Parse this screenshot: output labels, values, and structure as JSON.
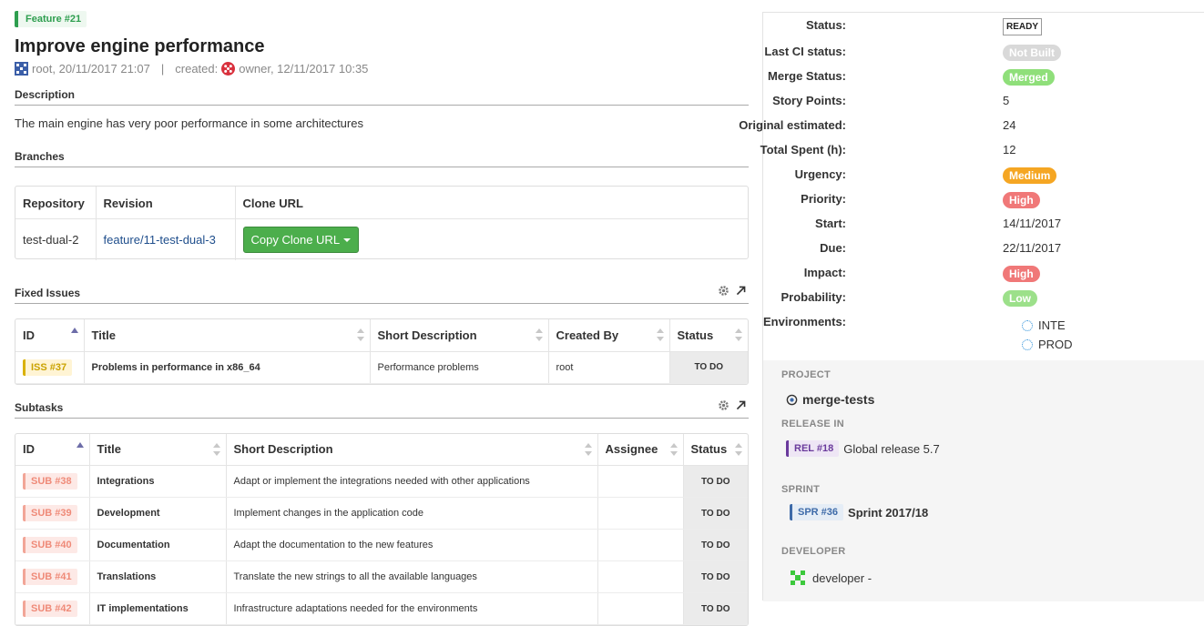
{
  "feature": {
    "badge": "Feature #21",
    "title": "Improve engine performance",
    "modified_by": "root, 20/11/2017 21:07",
    "separator": "|",
    "created_label": "created:",
    "created_by": "owner, 12/11/2017 10:35"
  },
  "description": {
    "heading": "Description",
    "text": "The main engine has very poor performance in some architectures"
  },
  "branches": {
    "heading": "Branches",
    "columns": [
      "Repository",
      "Revision",
      "Clone URL"
    ],
    "row": {
      "repository": "test-dual-2",
      "revision": "feature/11-test-dual-3",
      "clone_button": "Copy Clone URL"
    }
  },
  "fixed_issues": {
    "heading": "Fixed Issues",
    "columns": [
      "ID",
      "Title",
      "Short Description",
      "Created By",
      "Status"
    ],
    "rows": [
      {
        "id": "ISS #37",
        "title": "Problems in performance in x86_64",
        "short": "Performance problems",
        "created_by": "root",
        "status": "TO DO"
      }
    ]
  },
  "subtasks": {
    "heading": "Subtasks",
    "columns": [
      "ID",
      "Title",
      "Short Description",
      "Assignee",
      "Status"
    ],
    "rows": [
      {
        "id": "SUB #38",
        "title": "Integrations",
        "short": "Adapt or implement the integrations needed with other applications",
        "assignee": "",
        "status": "TO DO"
      },
      {
        "id": "SUB #39",
        "title": "Development",
        "short": "Implement changes in the application code",
        "assignee": "",
        "status": "TO DO"
      },
      {
        "id": "SUB #40",
        "title": "Documentation",
        "short": "Adapt the documentation to the new features",
        "assignee": "",
        "status": "TO DO"
      },
      {
        "id": "SUB #41",
        "title": "Translations",
        "short": "Translate the new strings to all the available languages",
        "assignee": "",
        "status": "TO DO"
      },
      {
        "id": "SUB #42",
        "title": "IT implementations",
        "short": "Infrastructure adaptations needed for the environments",
        "assignee": "",
        "status": "TO DO"
      }
    ]
  },
  "properties": {
    "status": {
      "label": "Status:",
      "value": "READY"
    },
    "last_ci": {
      "label": "Last CI status:",
      "value": "Not Built",
      "color": "#d9d9d9"
    },
    "merge": {
      "label": "Merge Status:",
      "value": "Merged",
      "color": "#8fdf7a"
    },
    "story_points": {
      "label": "Story Points:",
      "value": "5"
    },
    "original_estimated": {
      "label": "Original estimated:",
      "value": "24"
    },
    "total_spent": {
      "label": "Total Spent (h):",
      "value": "12"
    },
    "urgency": {
      "label": "Urgency:",
      "value": "Medium",
      "color": "#f5a623"
    },
    "priority": {
      "label": "Priority:",
      "value": "High",
      "color": "#f07878"
    },
    "start": {
      "label": "Start:",
      "value": "14/11/2017"
    },
    "due": {
      "label": "Due:",
      "value": "22/11/2017"
    },
    "impact": {
      "label": "Impact:",
      "value": "High",
      "color": "#f07878"
    },
    "probability": {
      "label": "Probability:",
      "value": "Low",
      "color": "#9ce08a"
    },
    "environments": {
      "label": "Environments:",
      "values": [
        "INTE",
        "PROD"
      ]
    }
  },
  "project": {
    "label": "PROJECT",
    "name": "merge-tests"
  },
  "release": {
    "label": "RELEASE IN",
    "tag": "REL #18",
    "name": "Global release 5.7"
  },
  "sprint": {
    "label": "SPRINT",
    "tag": "SPR #36",
    "name": "Sprint 2017/18"
  },
  "developer": {
    "label": "DEVELOPER",
    "name": "developer -"
  }
}
